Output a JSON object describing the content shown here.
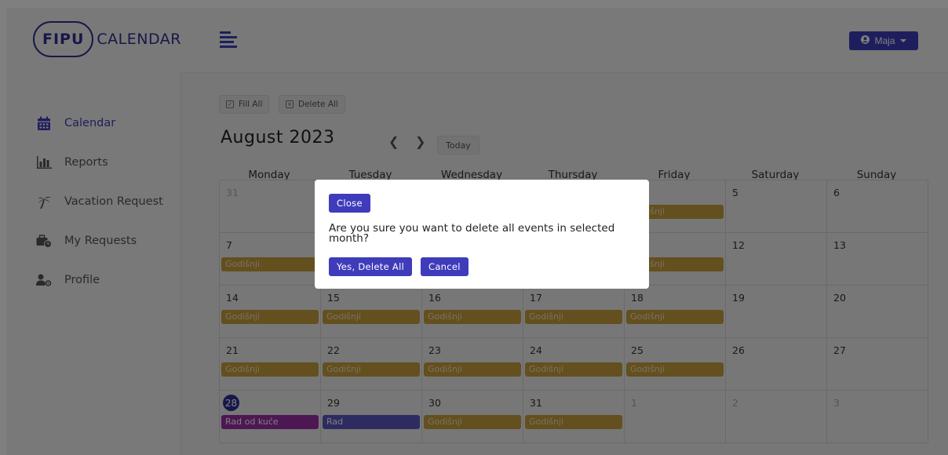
{
  "app": {
    "logo_mark": "FIPU",
    "logo_text": "CALENDAR",
    "user_name": "Maja",
    "brand_color": "#3f3cbb"
  },
  "sidebar": {
    "items": [
      {
        "label": "Calendar",
        "icon": "calendar-icon",
        "active": true
      },
      {
        "label": "Reports",
        "icon": "bar-chart-icon",
        "active": false
      },
      {
        "label": "Vacation Request",
        "icon": "palm-tree-icon",
        "active": false
      },
      {
        "label": "My Requests",
        "icon": "briefcase-clock-icon",
        "active": false
      },
      {
        "label": "Profile",
        "icon": "user-cog-icon",
        "active": false
      }
    ]
  },
  "toolbar": {
    "fill_all": "Fill All",
    "delete_all": "Delete All",
    "today": "Today"
  },
  "calendar": {
    "title": "August 2023",
    "weekdays": [
      "Monday",
      "Tuesday",
      "Wednesday",
      "Thursday",
      "Friday",
      "Saturday",
      "Sunday"
    ],
    "weeks": [
      [
        {
          "day": "31",
          "muted": true
        },
        {
          "day": ""
        },
        {
          "day": ""
        },
        {
          "day": ""
        },
        {
          "day": "",
          "event": "Godišnji",
          "event_color": "#c89f3c"
        },
        {
          "day": "5"
        },
        {
          "day": "6"
        }
      ],
      [
        {
          "day": "7",
          "event": "Godišnji",
          "event_color": "#c89f3c"
        },
        {
          "day": ""
        },
        {
          "day": ""
        },
        {
          "day": ""
        },
        {
          "day": "",
          "event": "Godišnji",
          "event_color": "#c89f3c"
        },
        {
          "day": "12"
        },
        {
          "day": "13"
        }
      ],
      [
        {
          "day": "14",
          "event": "Godišnji",
          "event_color": "#c89f3c"
        },
        {
          "day": "15",
          "event": "Godišnji",
          "event_color": "#c89f3c"
        },
        {
          "day": "16",
          "event": "Godišnji",
          "event_color": "#c89f3c"
        },
        {
          "day": "17",
          "event": "Godišnji",
          "event_color": "#c89f3c"
        },
        {
          "day": "18",
          "event": "Godišnji",
          "event_color": "#c89f3c"
        },
        {
          "day": "19"
        },
        {
          "day": "20"
        }
      ],
      [
        {
          "day": "21",
          "event": "Godišnji",
          "event_color": "#c89f3c"
        },
        {
          "day": "22",
          "event": "Godišnji",
          "event_color": "#c89f3c"
        },
        {
          "day": "23",
          "event": "Godišnji",
          "event_color": "#c89f3c"
        },
        {
          "day": "24",
          "event": "Godišnji",
          "event_color": "#c89f3c"
        },
        {
          "day": "25",
          "event": "Godišnji",
          "event_color": "#c89f3c"
        },
        {
          "day": "26"
        },
        {
          "day": "27"
        }
      ],
      [
        {
          "day": "28",
          "today": true,
          "event": "Rad od kuće",
          "event_color": "#9b2ea8"
        },
        {
          "day": "29",
          "event": "Rad",
          "event_color": "#5a57c0"
        },
        {
          "day": "30",
          "event": "Godišnji",
          "event_color": "#c89f3c"
        },
        {
          "day": "31",
          "event": "Godišnji",
          "event_color": "#c89f3c"
        },
        {
          "day": "1",
          "muted": true
        },
        {
          "day": "2",
          "muted": true
        },
        {
          "day": "3",
          "muted": true
        }
      ]
    ]
  },
  "modal": {
    "close_label": "Close",
    "message": "Are you sure you want to delete all events in selected month?",
    "confirm_label": "Yes, Delete All",
    "cancel_label": "Cancel"
  }
}
